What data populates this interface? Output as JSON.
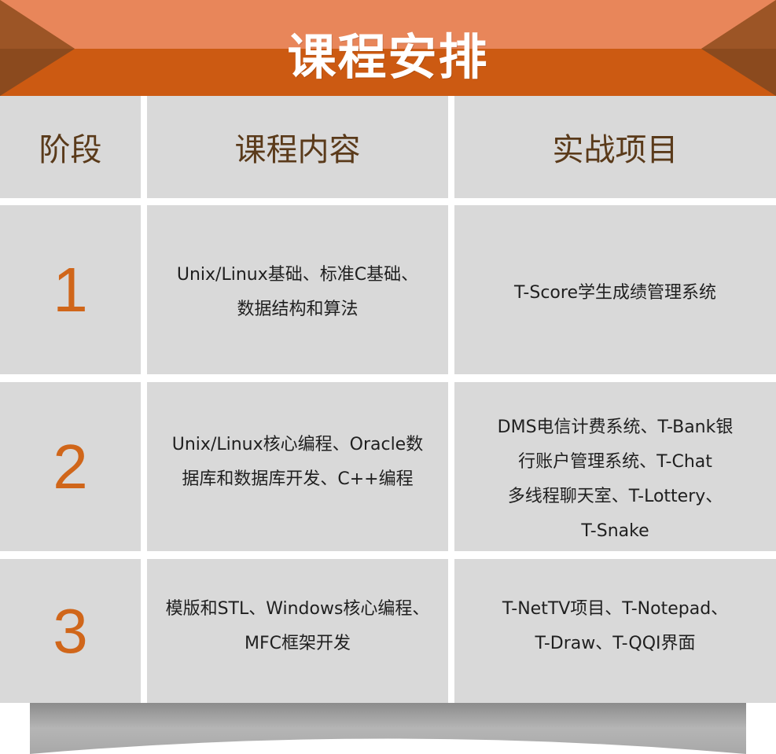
{
  "title": "课程安排",
  "colors": {
    "banner_top": "#e8865a",
    "banner_main": "#cc5a12",
    "corner": "#8b4a1e",
    "cell_bg": "#d9d9d9",
    "header_text": "#5a3a1a",
    "stage_number": "#d0661a",
    "bottom_strip": "#9a9a9a"
  },
  "headers": {
    "stage": "阶段",
    "content": "课程内容",
    "project": "实战项目"
  },
  "rows": [
    {
      "stage": "1",
      "content_lines": [
        "Unix/Linux基础、标准C基础、",
        "数据结构和算法"
      ],
      "project_lines": [
        "T-Score学生成绩管理系统"
      ]
    },
    {
      "stage": "2",
      "content_lines": [
        "Unix/Linux核心编程、Oracle数",
        "据库和数据库开发、C++编程"
      ],
      "project_lines": [
        "DMS电信计费系统、T-Bank银",
        "行账户管理系统、T-Chat",
        "多线程聊天室、T-Lottery、",
        "T-Snake"
      ]
    },
    {
      "stage": "3",
      "content_lines": [
        "模版和STL、Windows核心编程、",
        "MFC框架开发"
      ],
      "project_lines": [
        "T-NetTV项目、T-Notepad、",
        "T-Draw、T-QQI界面"
      ]
    }
  ]
}
